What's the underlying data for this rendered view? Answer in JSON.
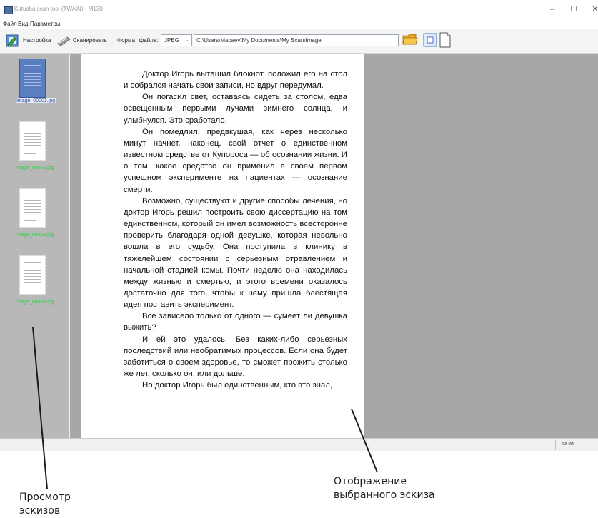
{
  "window": {
    "title": "Katusha scan tool (TWAIN) - M130",
    "controls": {
      "minimize": "–",
      "maximize": "☐",
      "close": "✕"
    }
  },
  "menu": {
    "items": [
      "Файл",
      "Вид",
      "Параметры"
    ]
  },
  "toolbar": {
    "settings_label": "Настройка",
    "scan_label": "Сканировать",
    "format_label": "Формат файла:",
    "format_value": "JPEG",
    "path_value": "C:\\Users\\Macaev\\My Documents\\My Scan\\Image",
    "icons": [
      "settings-icon",
      "scan-icon",
      "folder-icon",
      "fit-page-icon",
      "single-page-icon"
    ]
  },
  "thumbnails": {
    "items": [
      {
        "label": "Image_00001.jpg",
        "selected": true
      },
      {
        "label": "Image_00002.jpg",
        "selected": false
      },
      {
        "label": "Image_00003.jpg",
        "selected": false
      },
      {
        "label": "Image_00004.jpg",
        "selected": false
      }
    ],
    "colors": {
      "selected_label": "#2f4f9f",
      "label": "#2fd04a",
      "panel_bg": "#b8b8b8"
    }
  },
  "preview": {
    "paragraphs": [
      "Доктор Игорь вытащил блокнот, положил его на стол и собрался начать свои записи, но вдруг передумал.",
      "Он погасил свет, оставаясь сидеть за столом, едва освещенным первыми лучами зимнего солнца, и улыбнулся. Это сработало.",
      "Он помедлил, предвкушая, как через несколько минут начнет, наконец, свой отчет о единственном известном средстве от Купороса — об осознании жизни. И о том, какое средство он применил в своем первом успешном эксперименте на пациентах — осознание смерти.",
      "Возможно, существуют и другие способы лечения, но доктор Игорь решил построить свою диссертацию на том единственном, который он имел возможность всесторонне проверить благодаря одной девушке, которая невольно вошла в его судьбу. Она поступила в клинику в тяжелейшем состоянии с серьезным отравлением и начальной стадией комы. Почти неделю она находилась между жизнью и смертью, и этого времени оказалось достаточно для того, чтобы к нему пришла блестящая идея поставить эксперимент.",
      "Все зависело только от одного — сумеет ли девушка выжить?",
      "И ей это удалось. Без каких-либо серьезных последствий или необратимых процессов. Если она будет заботиться о своем здоровье, то сможет прожить столько же лет, сколько он, или дольше.",
      "Но доктор Игорь был единственным, кто это знал,"
    ]
  },
  "statusbar": {
    "num": "NUM"
  },
  "annotations": {
    "thumbs_caption": "Просмотр эскизов",
    "viewer_caption": "Отображение выбранного эскиза"
  }
}
